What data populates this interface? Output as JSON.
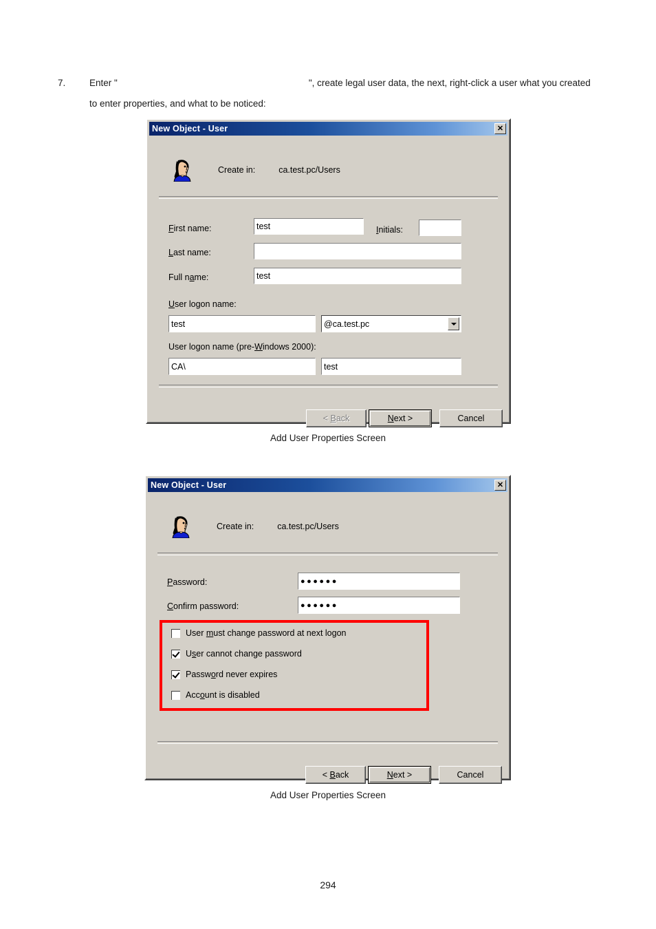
{
  "document": {
    "step_number": "7.",
    "step_text_before": "Enter \"",
    "step_text_after": "\", create legal user data, the next, right-click a user what you created",
    "step_line2": "to enter properties, and what to be noticed:",
    "page_number": "294"
  },
  "figure_captions": {
    "first": "Add User Properties Screen",
    "second": "Add User Properties Screen"
  },
  "dialog1": {
    "title": "New Object - User",
    "close_icon": "close-icon",
    "user_icon": "user-head-icon",
    "create_in_label": "Create in:",
    "create_in_value": "ca.test.pc/Users",
    "fields": {
      "first_name": {
        "label_pre": "F",
        "label_post": "irst name:",
        "value": "test",
        "placeholder": ""
      },
      "initials": {
        "label_pre": "I",
        "label_post": "nitials:",
        "value": "",
        "placeholder": ""
      },
      "last_name": {
        "label_pre": "L",
        "label_post": "ast name:",
        "value": "",
        "placeholder": ""
      },
      "full_name": {
        "label_pre": "Full n",
        "label_acc": "a",
        "label_post": "me:",
        "value": "test",
        "placeholder": ""
      },
      "user_logon_name": {
        "label_pre": "U",
        "label_post": "ser logon name:",
        "value": "test",
        "placeholder": ""
      },
      "domain_suffix": {
        "selected": "@ca.test.pc",
        "arrow_icon": "chevron-down-icon"
      },
      "pre_windows_logon": {
        "label_p1": "User logon name (pre-",
        "label_acc": "W",
        "label_p2": "indows 2000):",
        "domain_value": "CA\\",
        "value": "test"
      }
    },
    "buttons": {
      "back": {
        "pre": "< ",
        "acc": "B",
        "post": "ack",
        "enabled": false
      },
      "next": {
        "pre": "",
        "acc": "N",
        "post": "ext >",
        "enabled": true,
        "default": true
      },
      "cancel": {
        "label": "Cancel",
        "enabled": true
      }
    }
  },
  "dialog2": {
    "title": "New Object - User",
    "close_icon": "close-icon",
    "user_icon": "user-head-icon",
    "create_in_label": "Create in:",
    "create_in_value": "ca.test.pc/Users",
    "fields": {
      "password": {
        "label_pre": "P",
        "label_post": "assword:",
        "value": "●●●●●●"
      },
      "confirm_password": {
        "label_pre": "C",
        "label_post": "onfirm password:",
        "value": "●●●●●●"
      }
    },
    "highlight_color": "#ff0000",
    "checkboxes": [
      {
        "p1": "User ",
        "acc": "m",
        "p2": "ust change password at next logon",
        "checked": false
      },
      {
        "p1": "U",
        "acc": "s",
        "p2": "er cannot change password",
        "checked": true
      },
      {
        "p1": "Passw",
        "acc": "o",
        "p2": "rd never expires",
        "checked": true
      },
      {
        "p1": "Acc",
        "acc": "o",
        "p2": "unt is disabled",
        "checked": false
      }
    ],
    "buttons": {
      "back": {
        "pre": "< ",
        "acc": "B",
        "post": "ack",
        "enabled": true
      },
      "next": {
        "pre": "",
        "acc": "N",
        "post": "ext >",
        "enabled": true,
        "default": true
      },
      "cancel": {
        "label": "Cancel",
        "enabled": true
      }
    }
  }
}
